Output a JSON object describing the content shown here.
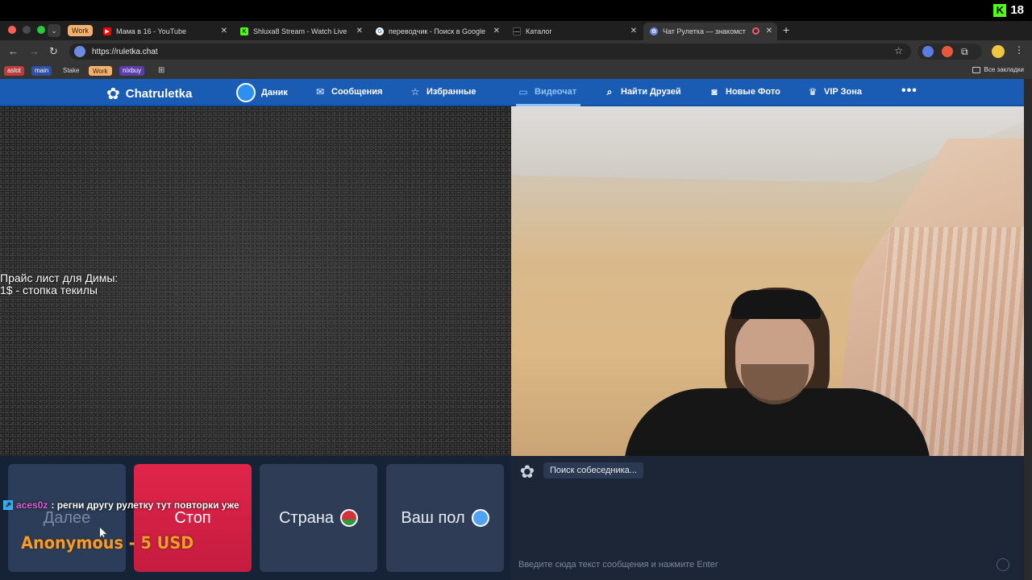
{
  "overlay_top": {
    "viewers": "18"
  },
  "browser": {
    "tab_group_label": "Work",
    "tabs": [
      {
        "title": "Мама в 16 - YouTube",
        "favicon_color": "#ff0000"
      },
      {
        "title": "Shluxa8 Stream - Watch Live",
        "favicon_color": "#53fc18"
      },
      {
        "title": "переводчик - Поиск в Google",
        "favicon_color": "#4285f4"
      },
      {
        "title": "Каталог",
        "favicon_color": "#111111"
      },
      {
        "title": "Чат Рулетка — знакомст",
        "favicon_color": "#6c8ae0"
      }
    ],
    "url": "https://ruletka.chat",
    "bookmarks": [
      {
        "label": "aslot",
        "color": "#c23b3b",
        "text_color": "#ffffff"
      },
      {
        "label": "main",
        "color": "#2d4fa8",
        "text_color": "#ffffff"
      },
      {
        "label": "Stake",
        "color": "transparent",
        "text_color": "#dddddd"
      },
      {
        "label": "Work",
        "color": "#f3b06e",
        "text_color": "#3a2208"
      },
      {
        "label": "nixbuy",
        "color": "#5b3fa8",
        "text_color": "#ffffff"
      }
    ],
    "all_bookmarks": "Все закладки"
  },
  "site_nav": {
    "brand": "Chatruletka",
    "user": "Даник",
    "messages": "Сообщения",
    "favorites": "Избранные",
    "videochat": "Видеочат",
    "find_friends": "Найти Друзей",
    "new_photos": "Новые Фото",
    "vip": "VIP Зона",
    "more": "•••"
  },
  "overlay": {
    "line1": "Прайс лист для Димы:",
    "line2": "1$ - стопка текилы"
  },
  "controls": {
    "next": "Далее",
    "stop": "Стоп",
    "country": "Страна",
    "gender": "Ваш пол"
  },
  "stream_chat": {
    "user": "aces0z",
    "message": ": регни другу рулетку тут повторки уже",
    "donation": "Anonymous - 5 USD"
  },
  "chat_panel": {
    "status": "Поиск собеседника...",
    "input_placeholder": "Введите сюда текст сообщения и нажмите Enter"
  }
}
